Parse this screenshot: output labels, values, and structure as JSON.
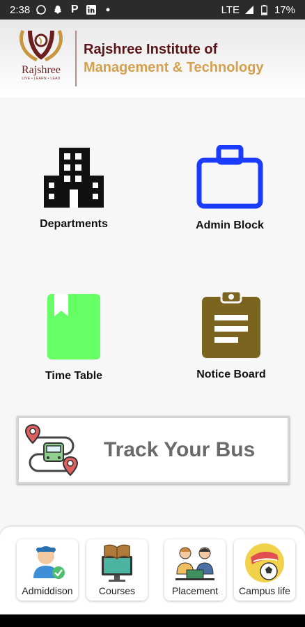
{
  "status_bar": {
    "time": "2:38",
    "network": "LTE",
    "battery": "17%",
    "notification_icons": [
      "whatsapp-icon",
      "snapchat-icon",
      "p-icon",
      "linkedin-icon",
      "dot-icon"
    ]
  },
  "header": {
    "logo_name": "Rajshree",
    "logo_tagline": "LIVE • LEARN • LEAD",
    "title_line1": "Rajshree Institute of",
    "title_line2": "Management & Technology"
  },
  "tiles": [
    {
      "label": "Departments",
      "icon": "building-icon",
      "color": "#111111"
    },
    {
      "label": "Admin Block",
      "icon": "briefcase-icon",
      "color": "#1a3cff"
    },
    {
      "label": "Time Table",
      "icon": "bookmark-book-icon",
      "color": "#66ff66"
    },
    {
      "label": "Notice Board",
      "icon": "clipboard-icon",
      "color": "#7a6420"
    }
  ],
  "bus_card": {
    "label": "Track Your Bus",
    "icon": "bus-route-icon"
  },
  "quick_links": [
    {
      "label": "Admiddison",
      "icon": "student-admission-icon"
    },
    {
      "label": "Courses",
      "icon": "book-monitor-icon"
    },
    {
      "label": "Placement",
      "icon": "interview-icon"
    },
    {
      "label": "Campus life",
      "icon": "sports-icon"
    }
  ]
}
